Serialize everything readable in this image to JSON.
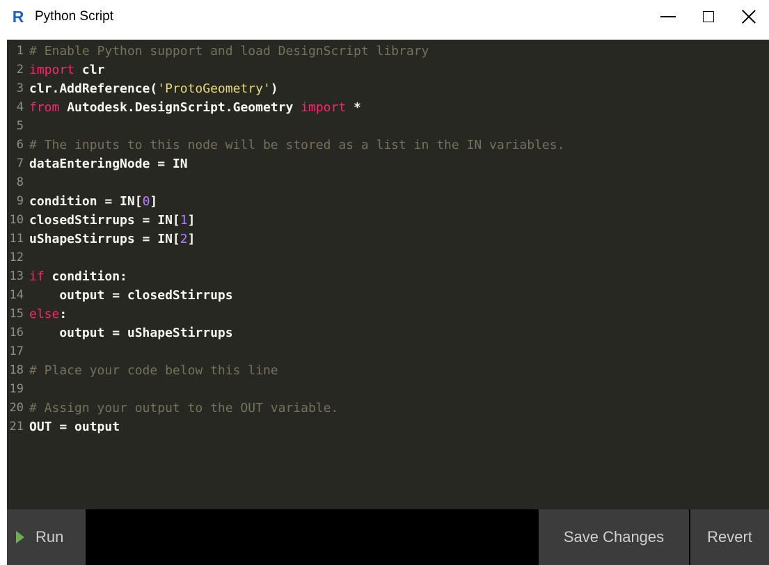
{
  "window": {
    "title": "Python Script",
    "app_icon_letter": "R",
    "app_icon_color": "#1b63c9"
  },
  "editor": {
    "background": "#272822",
    "lines": [
      {
        "n": "1",
        "parts": [
          {
            "t": "# Enable Python support and load DesignScript library",
            "c": "cmt"
          }
        ]
      },
      {
        "n": "2",
        "parts": [
          {
            "t": "import",
            "c": "kw"
          },
          {
            "t": " clr",
            "c": "bold"
          }
        ]
      },
      {
        "n": "3",
        "parts": [
          {
            "t": "clr.AddReference(",
            "c": "bold"
          },
          {
            "t": "'ProtoGeometry'",
            "c": "str"
          },
          {
            "t": ")",
            "c": "bold"
          }
        ]
      },
      {
        "n": "4",
        "parts": [
          {
            "t": "from",
            "c": "kw"
          },
          {
            "t": " Autodesk.DesignScript.Geometry ",
            "c": "bold"
          },
          {
            "t": "import",
            "c": "kw"
          },
          {
            "t": " *",
            "c": "bold"
          }
        ]
      },
      {
        "n": "5",
        "parts": []
      },
      {
        "n": "6",
        "parts": [
          {
            "t": "# The inputs to this node will be stored as a list in the IN variables.",
            "c": "cmt"
          }
        ]
      },
      {
        "n": "7",
        "parts": [
          {
            "t": "dataEnteringNode = IN",
            "c": "bold"
          }
        ]
      },
      {
        "n": "8",
        "parts": []
      },
      {
        "n": "9",
        "parts": [
          {
            "t": "condition = IN[",
            "c": "bold"
          },
          {
            "t": "0",
            "c": "num"
          },
          {
            "t": "]",
            "c": "bold"
          }
        ]
      },
      {
        "n": "10",
        "parts": [
          {
            "t": "closedStirrups = IN[",
            "c": "bold"
          },
          {
            "t": "1",
            "c": "num"
          },
          {
            "t": "]",
            "c": "bold"
          }
        ]
      },
      {
        "n": "11",
        "parts": [
          {
            "t": "uShapeStirrups = IN[",
            "c": "bold"
          },
          {
            "t": "2",
            "c": "num"
          },
          {
            "t": "]",
            "c": "bold"
          }
        ]
      },
      {
        "n": "12",
        "parts": []
      },
      {
        "n": "13",
        "parts": [
          {
            "t": "if",
            "c": "kw"
          },
          {
            "t": " condition:",
            "c": "bold"
          }
        ]
      },
      {
        "n": "14",
        "parts": [
          {
            "t": "    output = closedStirrups",
            "c": "bold"
          }
        ]
      },
      {
        "n": "15",
        "parts": [
          {
            "t": "else",
            "c": "kw"
          },
          {
            "t": ":",
            "c": "bold"
          }
        ]
      },
      {
        "n": "16",
        "parts": [
          {
            "t": "    output = uShapeStirrups",
            "c": "bold"
          }
        ]
      },
      {
        "n": "17",
        "parts": []
      },
      {
        "n": "18",
        "parts": [
          {
            "t": "# Place your code below this line",
            "c": "cmt"
          }
        ]
      },
      {
        "n": "19",
        "parts": []
      },
      {
        "n": "20",
        "parts": [
          {
            "t": "# Assign your output to the OUT variable.",
            "c": "cmt"
          }
        ]
      },
      {
        "n": "21",
        "parts": [
          {
            "t": "OUT = output",
            "c": "bold"
          }
        ]
      }
    ]
  },
  "toolbar": {
    "run_label": "Run",
    "save_label": "Save Changes",
    "revert_label": "Revert",
    "run_icon": "play-icon",
    "run_icon_color": "#67b04a"
  }
}
